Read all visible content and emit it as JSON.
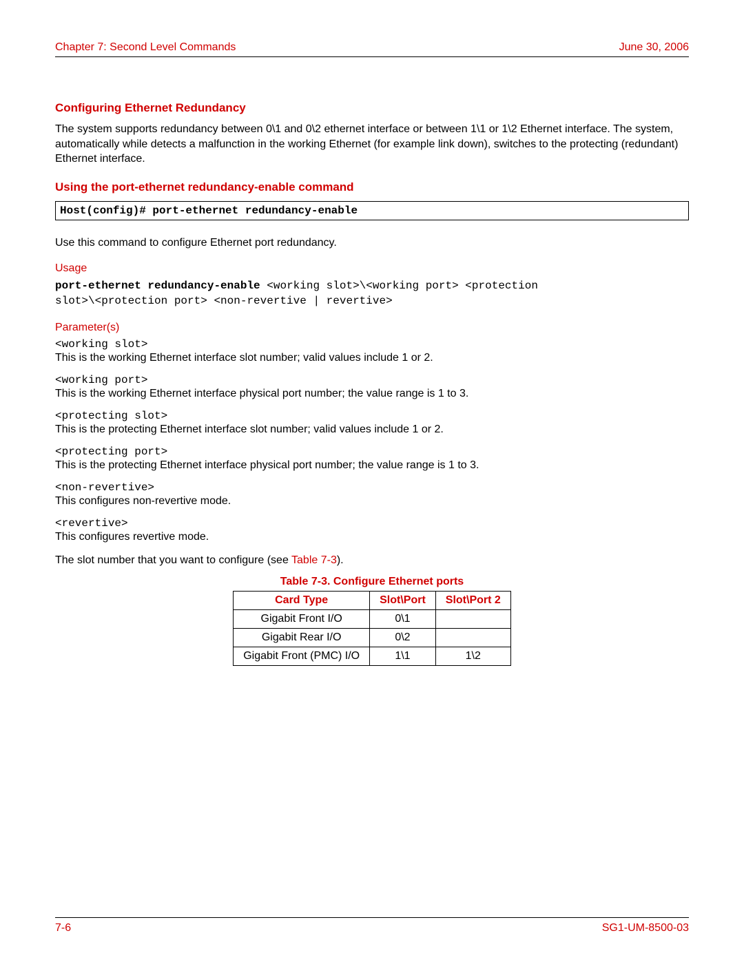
{
  "header": {
    "left": "Chapter 7: Second Level Commands",
    "right": "June 30, 2006"
  },
  "footer": {
    "left": "7-6",
    "right": "SG1-UM-8500-03"
  },
  "s1": {
    "title": "Configuring Ethernet Redundancy",
    "body": "The system supports redundancy between 0\\1 and 0\\2 ethernet interface or between 1\\1 or 1\\2 Ethernet interface. The system, automatically while detects a malfunction in the working Ethernet (for example link down), switches to the protecting (redundant) Ethernet interface."
  },
  "s2": {
    "title": "Using the port-ethernet redundancy-enable command",
    "command": "Host(config)# port-ethernet redundancy-enable",
    "desc": "Use this command to configure Ethernet port redundancy."
  },
  "usage": {
    "label": "Usage",
    "bold": "port-ethernet redundancy-enable",
    "rest1": " <working slot>\\<working port> <protection",
    "rest2": "slot>\\<protection port> <non-revertive | revertive>"
  },
  "params": {
    "label": "Parameter(s)",
    "items": [
      {
        "name": "<working slot>",
        "desc": "This is the working Ethernet interface slot number; valid values include 1 or 2."
      },
      {
        "name": "<working port>",
        "desc": "This is the working Ethernet interface physical port number; the value range is 1 to 3."
      },
      {
        "name": "<protecting slot>",
        "desc": "This is the protecting Ethernet interface slot number; valid values include 1 or 2."
      },
      {
        "name": "<protecting port>",
        "desc": "This is the protecting Ethernet interface physical port number; the value range is 1 to 3."
      },
      {
        "name": "<non-revertive>",
        "desc": "This configures non-revertive mode."
      },
      {
        "name": "<revertive>",
        "desc": "This configures revertive mode."
      }
    ],
    "note_pre": "The slot number that you want to configure (see ",
    "note_link": "Table 7-3",
    "note_post": ")."
  },
  "table": {
    "caption": "Table 7-3. Configure Ethernet ports",
    "headers": [
      "Card Type",
      "Slot\\Port",
      "Slot\\Port 2"
    ],
    "rows": [
      [
        "Gigabit Front I/O",
        "0\\1",
        ""
      ],
      [
        "Gigabit Rear I/O",
        "0\\2",
        ""
      ],
      [
        "Gigabit Front (PMC) I/O",
        "1\\1",
        "1\\2"
      ]
    ]
  }
}
